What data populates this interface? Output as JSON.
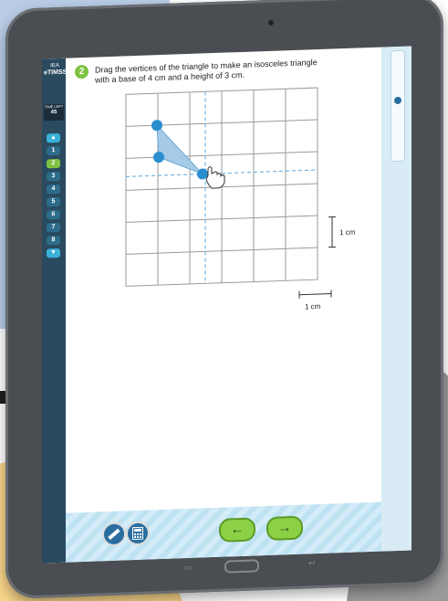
{
  "sidebar": {
    "logo_top": "IEA",
    "logo_bottom": "eTIMSS",
    "time_left_label": "TIME LEFT",
    "time_left_value": "45",
    "up_arrow": "▲",
    "down_arrow": "▼",
    "items": [
      "1",
      "2",
      "3",
      "4",
      "5",
      "6",
      "7",
      "8"
    ],
    "active_item": "2"
  },
  "question": {
    "number": "2",
    "text_line1": "Drag the vertices of the triangle to make an isosceles triangle",
    "text_line2": "with a base of 4 cm and a height of 3 cm."
  },
  "grid": {
    "scale_vertical_label": "1 cm",
    "scale_horizontal_label": "1 cm"
  },
  "toolbar": {
    "ruler_icon": "ruler-icon",
    "calculator_icon": "calculator-icon",
    "back_arrow": "←",
    "next_arrow": "→"
  },
  "colors": {
    "sidebar": "#2a4a60",
    "nav_button": "#39b0d8",
    "active_green": "#7ec242",
    "triangle_fill": "#a6cbe8",
    "vertex": "#2a8ed0"
  }
}
